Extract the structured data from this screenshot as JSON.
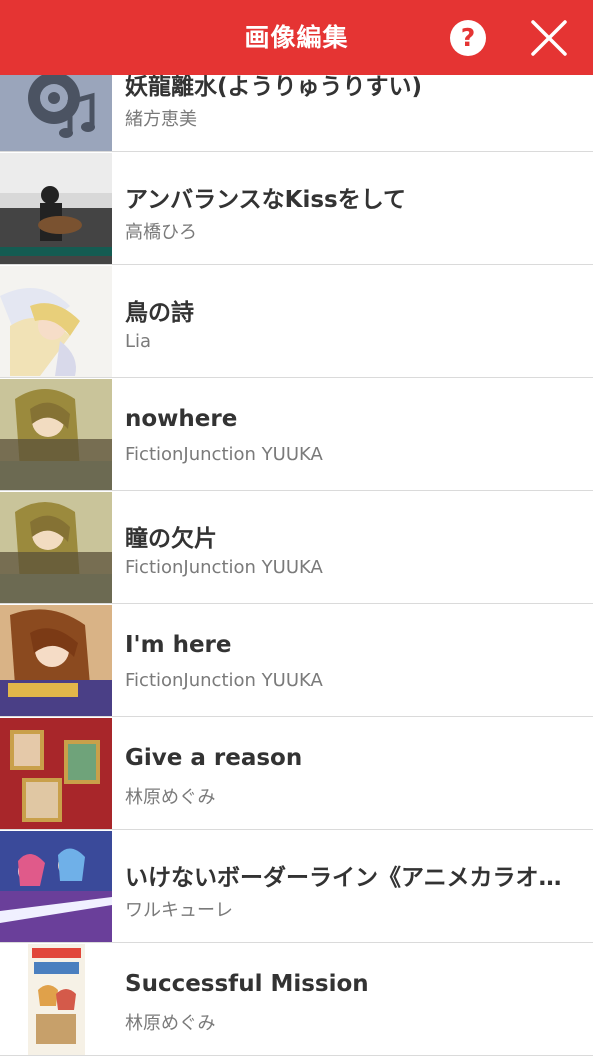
{
  "header": {
    "title": "画像編集",
    "help_icon": "?",
    "close_icon": "close-icon"
  },
  "colors": {
    "accent": "#e53433",
    "title_text": "#333333",
    "artist_text": "#7a7a7a",
    "divider": "#dadada"
  },
  "songs": [
    {
      "title": "妖龍離水(ようりゅうりすい)",
      "artist": "緒方恵美"
    },
    {
      "title": "アンバランスなKissをして",
      "artist": "高橋ひろ"
    },
    {
      "title": "鳥の詩",
      "artist": "Lia"
    },
    {
      "title": "nowhere",
      "artist": "FictionJunction YUUKA"
    },
    {
      "title": "瞳の欠片",
      "artist": "FictionJunction YUUKA"
    },
    {
      "title": "I'm here",
      "artist": "FictionJunction YUUKA"
    },
    {
      "title": "Give a reason",
      "artist": "林原めぐみ"
    },
    {
      "title": "いけないボーダーライン《アニメカラオケ》",
      "artist": "ワルキューレ"
    },
    {
      "title": "Successful Mission",
      "artist": "林原めぐみ"
    }
  ]
}
